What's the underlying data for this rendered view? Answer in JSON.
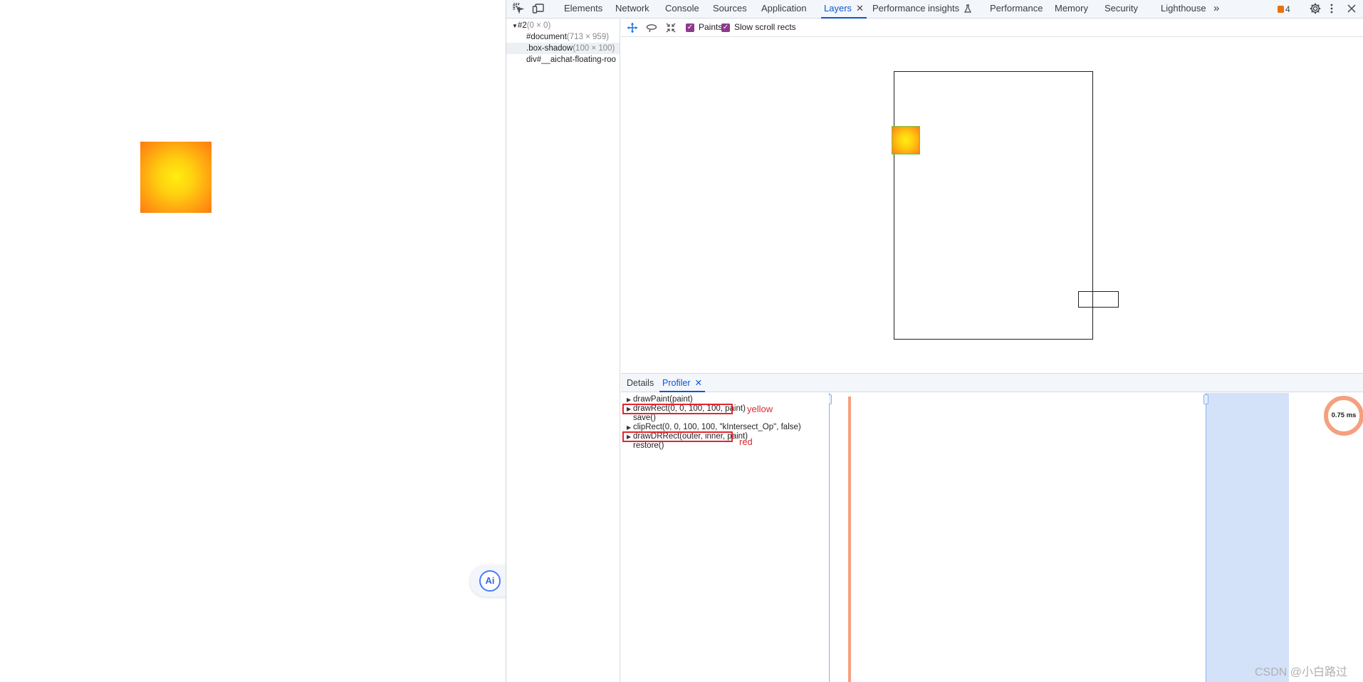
{
  "page": {
    "ai_button_text": "Ai"
  },
  "devtools": {
    "tabs": [
      {
        "label": "Elements"
      },
      {
        "label": "Network"
      },
      {
        "label": "Console"
      },
      {
        "label": "Sources"
      },
      {
        "label": "Application"
      },
      {
        "label": "Layers",
        "active": true
      },
      {
        "label": "Performance insights"
      },
      {
        "label": "Performance"
      },
      {
        "label": "Memory"
      },
      {
        "label": "Security"
      },
      {
        "label": "Lighthouse"
      }
    ],
    "issues_count": "4",
    "accent_color": "#0b57d0"
  },
  "layer_tree": [
    {
      "name": "#2",
      "dims": "(0 × 0)",
      "expanded": true
    },
    {
      "name": "#document",
      "dims": "(713 × 959)"
    },
    {
      "name": ".box-shadow",
      "dims": "(100 × 100)",
      "selected": true
    },
    {
      "name": "div#__aichat-floating-roo",
      "dims": ""
    }
  ],
  "layers_toolbar": {
    "paints_label": "Paints",
    "paints_checked": true,
    "slow_scroll_label": "Slow scroll rects",
    "slow_scroll_checked": true
  },
  "bottom_tabs": [
    {
      "label": "Details"
    },
    {
      "label": "Profiler",
      "active": true
    }
  ],
  "profiler": {
    "commands": [
      {
        "text": "drawPaint(paint)",
        "expandable": true
      },
      {
        "text": "drawRect(0, 0, 100, 100, paint)",
        "expandable": true,
        "highlighted": true
      },
      {
        "text": "save()",
        "expandable": false
      },
      {
        "text": "clipRect(0, 0, 100, 100, \"kIntersect_Op\", false)",
        "expandable": true
      },
      {
        "text": "drawDRRect(outer, inner, paint)",
        "expandable": true,
        "highlighted": true
      },
      {
        "text": "restore()",
        "expandable": false
      }
    ],
    "annotations": {
      "yellow": "yellow",
      "red": "red"
    },
    "pie_label": "0.75 ms"
  },
  "watermark": "CSDN @小白路过"
}
